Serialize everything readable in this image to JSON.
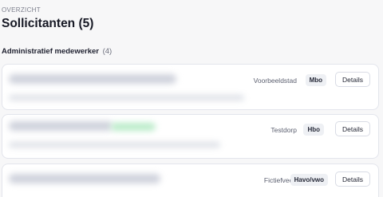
{
  "header": {
    "overline": "OVERZICHT",
    "title": "Sollicitanten (5)"
  },
  "section": {
    "title": "Administratief medewerker",
    "count": "(4)"
  },
  "applicants": [
    {
      "city": "Voorbeeldstad",
      "level": "Mbo",
      "action": "Details"
    },
    {
      "city": "Testdorp",
      "level": "Hbo",
      "action": "Details"
    },
    {
      "city": "Fictiefveen",
      "level": "Havo/vwo",
      "action": "Details"
    }
  ]
}
